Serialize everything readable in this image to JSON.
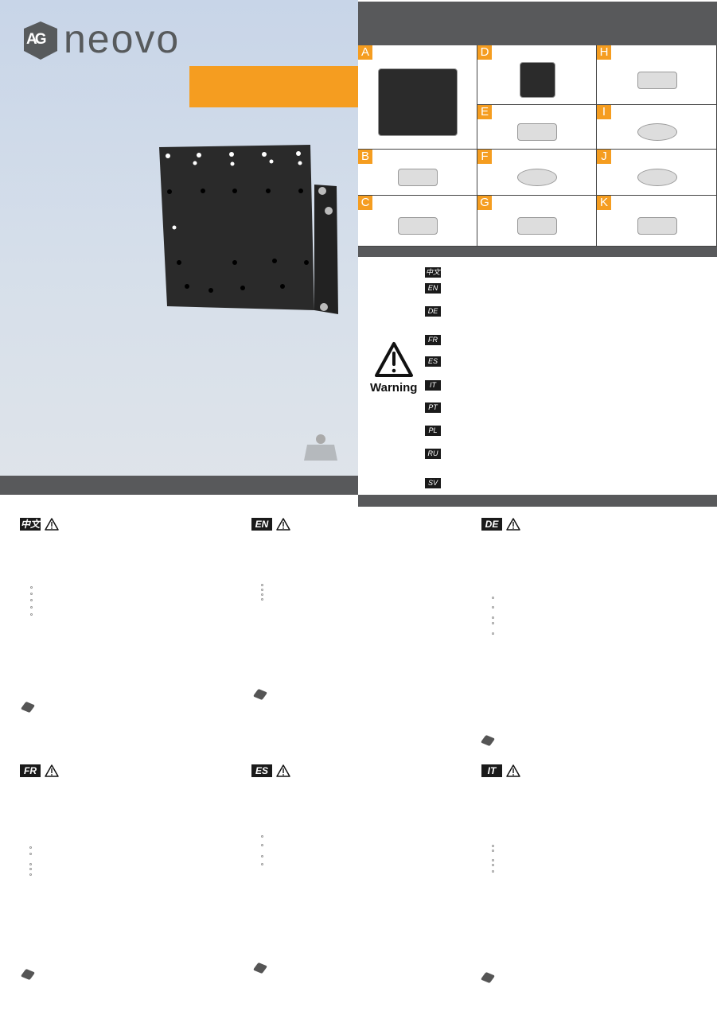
{
  "brand": {
    "logo_mark": "AG",
    "logo_text": "neovo"
  },
  "parts": [
    {
      "label": "A",
      "icon": "wall-plate"
    },
    {
      "label": "B",
      "icon": "wall-anchor"
    },
    {
      "label": "C",
      "icon": "lag-bolt"
    },
    {
      "label": "D",
      "icon": "display-bracket"
    },
    {
      "label": "E",
      "icon": "bolt-with-washer"
    },
    {
      "label": "F",
      "icon": "washer-and-spacer"
    },
    {
      "label": "G",
      "icon": "wrench"
    },
    {
      "label": "H",
      "icon": "hex-bolt"
    },
    {
      "label": "I",
      "icon": "washer"
    },
    {
      "label": "J",
      "icon": "nut"
    },
    {
      "label": "K",
      "icon": "screw"
    }
  ],
  "warning": {
    "label": "Warning",
    "languages": [
      "中文",
      "EN",
      "DE",
      "FR",
      "ES",
      "IT",
      "PT",
      "PL",
      "RU",
      "SV"
    ]
  },
  "sections": [
    {
      "lang": "中文"
    },
    {
      "lang": "EN"
    },
    {
      "lang": "DE"
    },
    {
      "lang": "FR"
    },
    {
      "lang": "ES"
    },
    {
      "lang": "IT"
    }
  ],
  "colors": {
    "accent": "#f59d20",
    "bar": "#58595b",
    "background": "#c8d5e8"
  }
}
